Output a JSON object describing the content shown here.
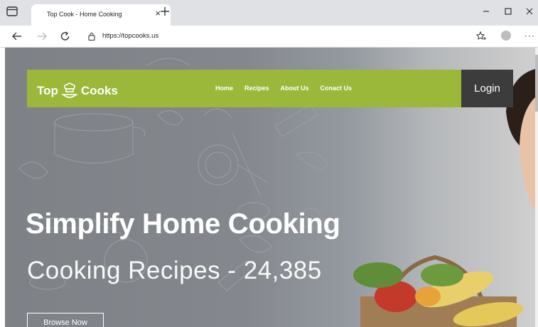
{
  "browser": {
    "tab_title": "Top Cook - Home Cooking",
    "tab_close": "×",
    "url": "https://topcooks.us",
    "menu_dots": "···"
  },
  "site": {
    "logo_left": "Top",
    "logo_right": "Cooks",
    "nav": [
      "Home",
      "Recipes",
      "About Us",
      "Conact Us"
    ],
    "login": "Login",
    "hero_title": "Simplify Home Cooking",
    "hero_subtitle": "Cooking Recipes - 24,385",
    "browse_button": "Browse Now"
  },
  "colors": {
    "nav_bg": "#9bb83a",
    "login_bg": "#3c3c3c",
    "hero_bg": "#82868c"
  }
}
